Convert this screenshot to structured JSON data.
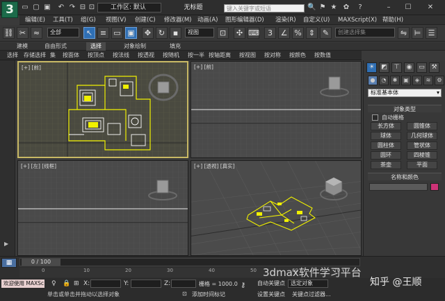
{
  "app": {
    "logo_glyph": "3",
    "workspace_label": "工作区: 默认",
    "window_title": "无标题",
    "search_placeholder": "键入关键字或短语"
  },
  "quick_access": [
    "▭",
    "▢",
    "▣",
    "↶",
    "↷",
    "⊟",
    "⊡"
  ],
  "title_icons": [
    "🔍",
    "⚑",
    "★",
    "✿",
    "?",
    "–",
    "☐",
    "✕"
  ],
  "menus": [
    "编辑(E)",
    "工具(T)",
    "组(G)",
    "视图(V)",
    "创建(C)",
    "修改器(M)",
    "动画(A)",
    "图形编辑器(D)",
    "渲染(R)",
    "自定义(U)",
    "MAXScript(X)",
    "帮助(H)"
  ],
  "toolbar": {
    "filter_value": "全部",
    "refcoord_value": "视图",
    "selset_placeholder": "创建选择集"
  },
  "ribbon_tabs": [
    "建模",
    "自由形式",
    "选择",
    "对象绘制",
    "填充"
  ],
  "ribbon_active": "选择",
  "ribbon_buttons": [
    "选择",
    "存储选择",
    "集",
    "按面体",
    "按顶点",
    "按法线",
    "按透视",
    "按随机",
    "按一半",
    "按轴距离",
    "按视图",
    "按对称",
    "按颜色",
    "按数值"
  ],
  "viewports": {
    "top_left": {
      "label": "[+] [前]"
    },
    "top_right": {
      "label": "[+] [前]"
    },
    "bottom_left": {
      "label": "[+] [左] [线框]"
    },
    "bottom_right": {
      "label": "[+] [透视] [真实]"
    }
  },
  "command_panel": {
    "category_value": "标准基本体",
    "object_type_header": "对象类型",
    "autogrid_label": "自动栅格",
    "buttons": [
      [
        "长方体",
        "圆锥体"
      ],
      [
        "球体",
        "几何球体"
      ],
      [
        "圆柱体",
        "管状体"
      ],
      [
        "圆环",
        "四棱锥"
      ],
      [
        "茶壶",
        "平面"
      ]
    ],
    "name_color_header": "名称和颜色",
    "object_color": "#cc3377"
  },
  "timeline": {
    "frame_counter": "0 / 100",
    "ticks": [
      "0",
      "10",
      "20",
      "30",
      "40",
      "50",
      "60",
      "70"
    ]
  },
  "status": {
    "maxscript_label": "欢迎使用 MAXSc",
    "prompt": "单击或单击并拖动以选择对象",
    "x_label": "X:",
    "y_label": "Y:",
    "z_label": "Z:",
    "grid_text": "栅格 = 1000.0",
    "auto_key": "自动关键点",
    "selected_obj": "选定对象",
    "set_key": "设置关键点",
    "key_filters": "关键点过滤器...",
    "add_tag": "添加时间标记"
  },
  "watermark": {
    "text1": "3dmax软件学习平台",
    "text2": "知乎 @王顺"
  }
}
